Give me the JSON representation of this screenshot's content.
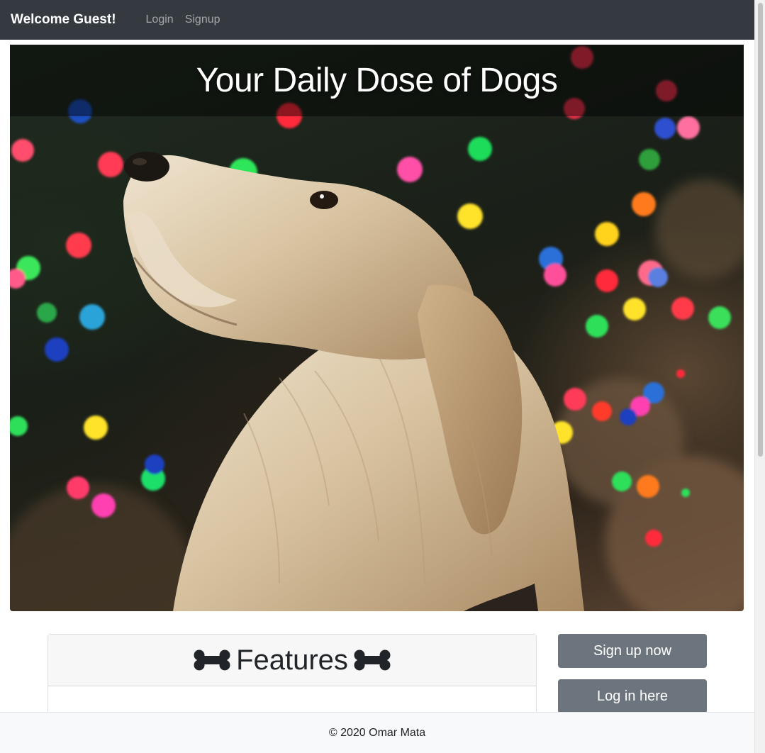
{
  "navbar": {
    "brand": "Welcome Guest!",
    "links": [
      {
        "label": "Login"
      },
      {
        "label": "Signup"
      }
    ]
  },
  "hero": {
    "title": "Your Daily Dose of Dogs",
    "image": "golden-retriever-with-bokeh-christmas-lights"
  },
  "features": {
    "title": "Features",
    "icons": [
      "bone-icon",
      "bone-icon"
    ]
  },
  "actions": {
    "signup_label": "Sign up now",
    "login_label": "Log in here"
  },
  "footer": {
    "text": "© 2020 Omar Mata"
  },
  "colors": {
    "navbar": "#343a40",
    "button": "#6c757d",
    "footer": "#f8f9fa"
  }
}
